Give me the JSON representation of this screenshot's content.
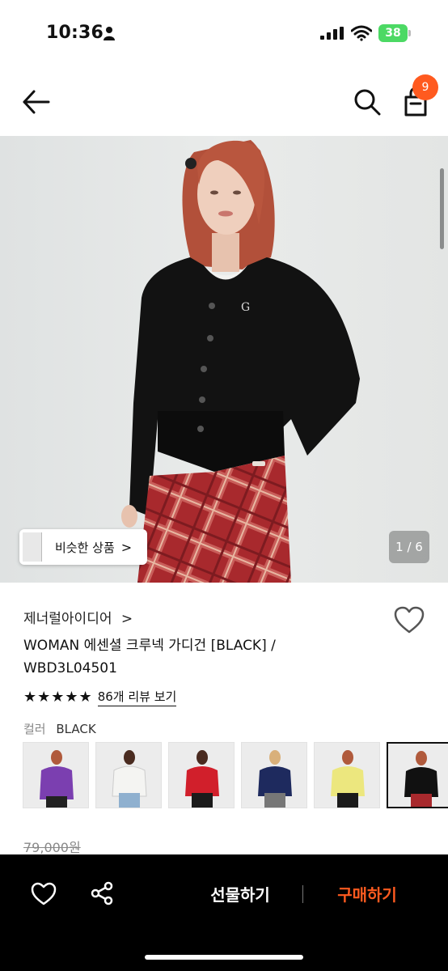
{
  "status_bar": {
    "time": "10:36",
    "battery": "38"
  },
  "header": {
    "back_icon": "arrow-left-icon",
    "search_icon": "search-icon",
    "cart_icon": "shopping-bag-icon",
    "cart_count": "9"
  },
  "hero": {
    "similar_label": "비슷한 상품",
    "similar_arrow": ">",
    "page_counter": "1 / 6"
  },
  "product": {
    "brand": "제너럴아이디어",
    "brand_arrow": ">",
    "title_line1": "WOMAN 에센셜 크루넥 가디건 [BLACK] /",
    "title_line2": "WBD3L04501",
    "stars": "★★★★★",
    "rating": 5,
    "review_link": "86개 리뷰 보기",
    "color_label": "컬러",
    "color_value": "BLACK",
    "color_swatches": [
      "purple",
      "white",
      "red",
      "navy",
      "yellow",
      "black"
    ],
    "original_price": "79,000원"
  },
  "bottom_bar": {
    "heart_icon": "heart-outline-icon",
    "share_icon": "share-icon",
    "gift_label": "선물하기",
    "buy_label": "구매하기"
  },
  "colors": {
    "accent": "#ff5a1f",
    "battery": "#4cd964",
    "bottom_bar": "#000000"
  }
}
